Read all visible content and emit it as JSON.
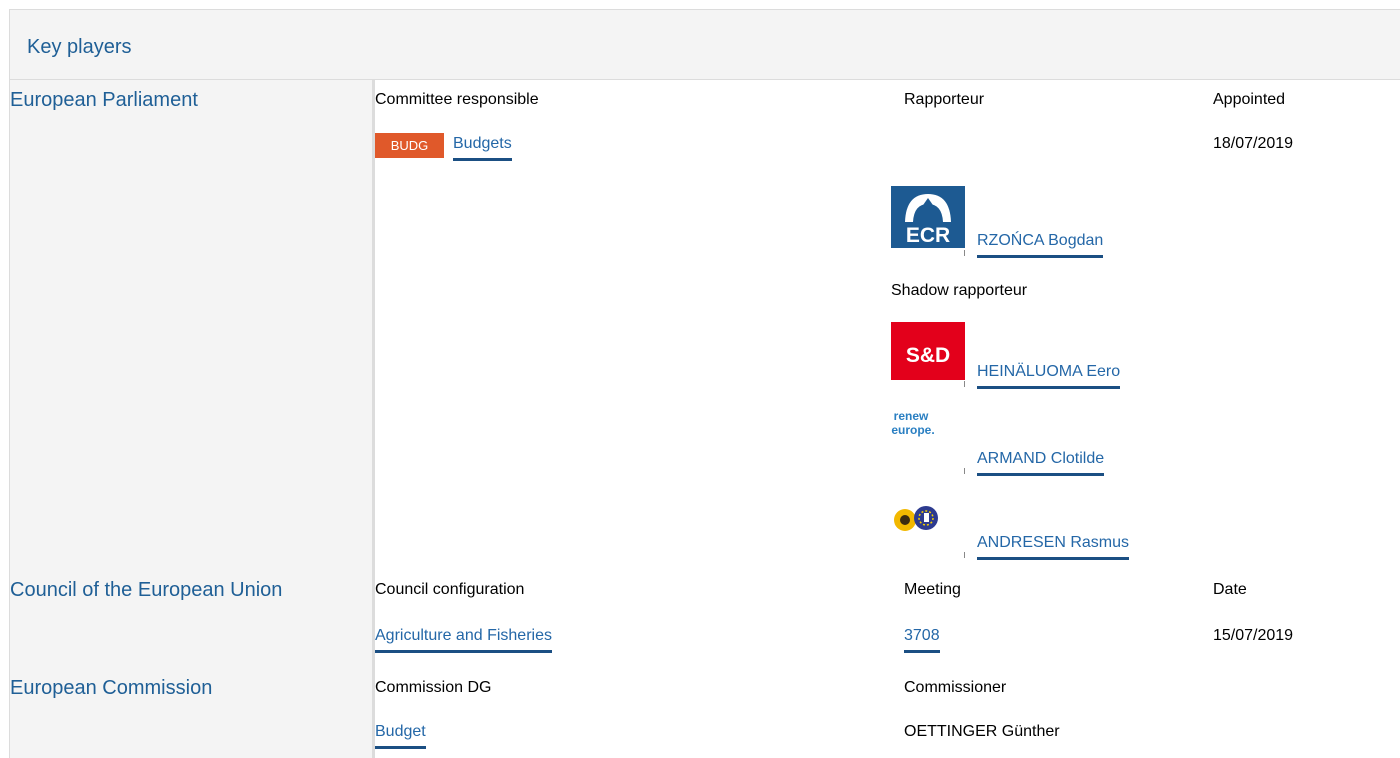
{
  "header": {
    "title": "Key players"
  },
  "parliament": {
    "label": "European Parliament",
    "col_committee": "Committee responsible",
    "col_rapporteur": "Rapporteur",
    "col_appointed": "Appointed",
    "committee_badge": "BUDG",
    "committee_name": "Budgets",
    "appointed_date": "18/07/2019",
    "rapporteur": {
      "name": "RZOŃCA Bogdan",
      "group_logo": "ECR"
    },
    "shadow_label": "Shadow rapporteur",
    "shadows": [
      {
        "name": "HEINÄLUOMA Eero",
        "group_logo": "S&D"
      },
      {
        "name": "ARMAND Clotilde",
        "group_logo_line1": "renew",
        "group_logo_line2": "europe."
      },
      {
        "name": "ANDRESEN Rasmus",
        "group_logo": "greens-efa-logo"
      }
    ]
  },
  "council": {
    "label": "Council of the European Union",
    "col_configuration": "Council configuration",
    "col_meeting": "Meeting",
    "col_date": "Date",
    "configuration": "Agriculture and Fisheries",
    "meeting": "3708",
    "date": "15/07/2019"
  },
  "commission": {
    "label": "European Commission",
    "col_dg": "Commission DG",
    "col_commissioner": "Commissioner",
    "dg": "Budget",
    "commissioner": "OETTINGER Günther"
  },
  "colors": {
    "accent_blue": "#1f5f96",
    "link_blue": "#2467a7",
    "badge_orange": "#e0592a",
    "panel_grey": "#f4f4f4"
  }
}
